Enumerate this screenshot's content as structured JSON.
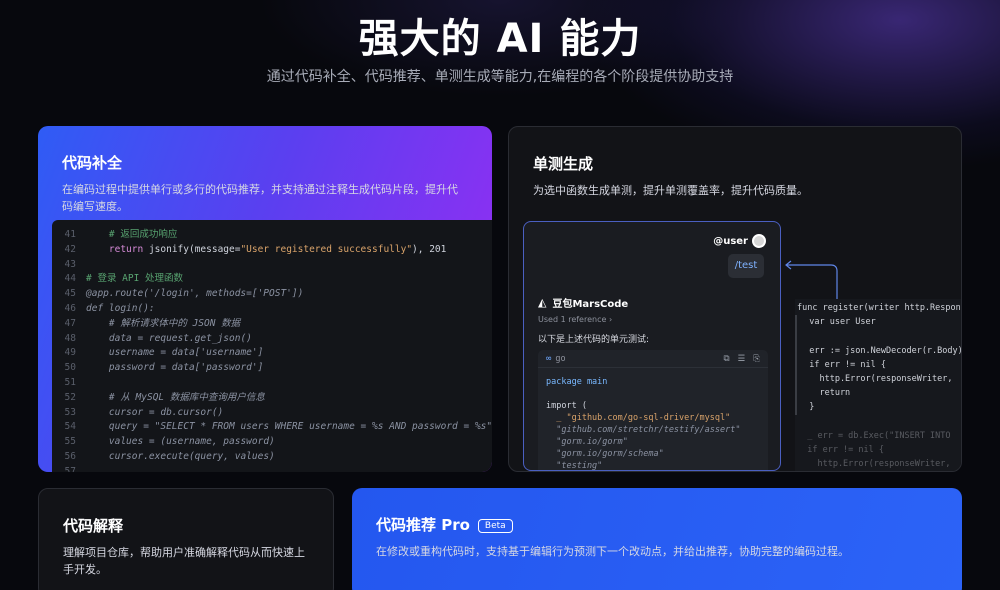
{
  "hero": {
    "title": "强大的 AI 能力",
    "subtitle": "通过代码补全、代码推荐、单测生成等能力,在编程的各个阶段提供协助支持"
  },
  "cards": {
    "complete": {
      "title": "代码补全",
      "desc": "在编码过程中提供单行或多行的代码推荐，并支持通过注释生成代码片段，提升代码编写速度。",
      "code": [
        {
          "n": "41",
          "indent": "    ",
          "parts": [
            {
              "t": "# 返回成功响应",
              "c": "tok-c"
            }
          ]
        },
        {
          "n": "42",
          "indent": "    ",
          "parts": [
            {
              "t": "return ",
              "c": "tok-k"
            },
            {
              "t": "jsonify(message=",
              "c": "tok-t"
            },
            {
              "t": "\"User registered successfully\"",
              "c": "tok-s"
            },
            {
              "t": "), 201",
              "c": "tok-t"
            }
          ]
        },
        {
          "n": "43",
          "indent": "",
          "parts": []
        },
        {
          "n": "44",
          "indent": "",
          "parts": [
            {
              "t": "# 登录 API 处理函数",
              "c": "tok-c"
            }
          ]
        },
        {
          "n": "45",
          "indent": "",
          "parts": [
            {
              "t": "@app.route('/login', methods=['POST'])",
              "c": "tok-d"
            }
          ]
        },
        {
          "n": "46",
          "indent": "",
          "parts": [
            {
              "t": "def login():",
              "c": "tok-d"
            }
          ]
        },
        {
          "n": "47",
          "indent": "    ",
          "parts": [
            {
              "t": "# 解析请求体中的 JSON 数据",
              "c": "tok-d"
            }
          ]
        },
        {
          "n": "48",
          "indent": "    ",
          "parts": [
            {
              "t": "data = request.get_json()",
              "c": "tok-d"
            }
          ]
        },
        {
          "n": "49",
          "indent": "    ",
          "parts": [
            {
              "t": "username = data['username']",
              "c": "tok-d"
            }
          ]
        },
        {
          "n": "50",
          "indent": "    ",
          "parts": [
            {
              "t": "password = data['password']",
              "c": "tok-d"
            }
          ]
        },
        {
          "n": "51",
          "indent": "",
          "parts": []
        },
        {
          "n": "52",
          "indent": "    ",
          "parts": [
            {
              "t": "# 从 MySQL 数据库中查询用户信息",
              "c": "tok-d"
            }
          ]
        },
        {
          "n": "53",
          "indent": "    ",
          "parts": [
            {
              "t": "cursor = db.cursor()",
              "c": "tok-d"
            }
          ]
        },
        {
          "n": "54",
          "indent": "    ",
          "parts": [
            {
              "t": "query = \"SELECT * FROM users WHERE username = %s AND password = %s\"",
              "c": "tok-d"
            }
          ]
        },
        {
          "n": "55",
          "indent": "    ",
          "parts": [
            {
              "t": "values = (username, password)",
              "c": "tok-d"
            }
          ]
        },
        {
          "n": "56",
          "indent": "    ",
          "parts": [
            {
              "t": "cursor.execute(query, values)",
              "c": "tok-d"
            }
          ]
        },
        {
          "n": "57",
          "indent": "",
          "parts": []
        }
      ]
    },
    "test": {
      "title": "单测生成",
      "desc": "为选中函数生成单测，提升单测覆盖率，提升代码质量。",
      "chat": {
        "user": "@user",
        "command": "/test",
        "bot_name": "豆包MarsCode",
        "reference": "Used 1 reference",
        "intro": "以下是上述代码的单元测试:",
        "lang": "go",
        "code": [
          "package main",
          "",
          "import (",
          "  _ \"github.com/go-sql-driver/mysql\"",
          "  \"github.com/stretchr/testify/assert\"",
          "  \"gorm.io/gorm\"",
          "  \"gorm.io/gorm/schema\"",
          "  \"testing\""
        ]
      },
      "diff": [
        "func register(writer http.Respon",
        "  var user User",
        "",
        "  err := json.NewDecoder(r.Body)",
        "  if err != nil {",
        "    http.Error(responseWriter,",
        "    return",
        "  }",
        "",
        "  _ err = db.Exec(\"INSERT INTO",
        "  if err != nil {",
        "    http.Error(responseWriter,"
      ]
    },
    "explain": {
      "title": "代码解释",
      "desc": "理解项目仓库，帮助用户准确解释代码从而快速上手开发。"
    },
    "predict": {
      "title": "代码推荐 Pro",
      "badge": "Beta",
      "desc": "在修改或重构代码时，支持基于编辑行为预测下一个改动点，并给出推荐，协助完整的编码过程。"
    }
  },
  "icons": {
    "bot_logo": "marscode-logo-icon",
    "lang": "infinity-icon",
    "tools": [
      "copy-icon",
      "insert-icon",
      "file-icon"
    ]
  }
}
